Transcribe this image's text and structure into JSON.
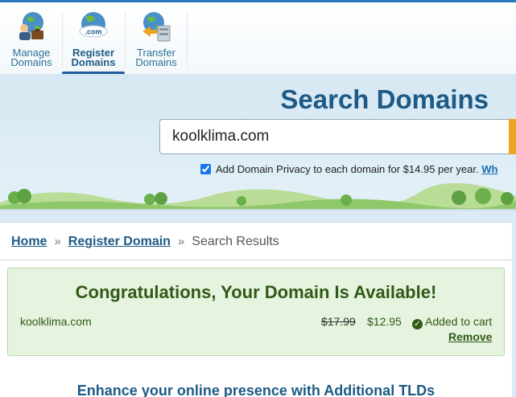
{
  "nav": {
    "items": [
      {
        "line1": "Manage",
        "line2": "Domains",
        "active": false
      },
      {
        "line1": "Register",
        "line2": "Domains",
        "active": true
      },
      {
        "line1": "Transfer",
        "line2": "Domains",
        "active": false
      }
    ],
    "com_badge": ".com"
  },
  "hero": {
    "title": "Search Domains",
    "search_value": "koolklima.com",
    "privacy_checked": true,
    "privacy_text": "Add Domain Privacy to each domain for $14.95 per year.",
    "privacy_link": "Wh"
  },
  "breadcrumb": {
    "home": "Home",
    "register": "Register Domain",
    "current": "Search Results",
    "separator": "»"
  },
  "result": {
    "title": "Congratulations, Your Domain Is Available!",
    "domain": "koolklima.com",
    "old_price": "$17.99",
    "new_price": "$12.95",
    "status": "Added to cart",
    "remove": "Remove"
  },
  "enhance": {
    "title": "Enhance your online presence with Additional TLDs"
  },
  "colors": {
    "brand_blue": "#1d5a86",
    "accent_orange": "#f0a321",
    "success_green": "#2f5a17",
    "success_bg": "#e6f3de"
  }
}
